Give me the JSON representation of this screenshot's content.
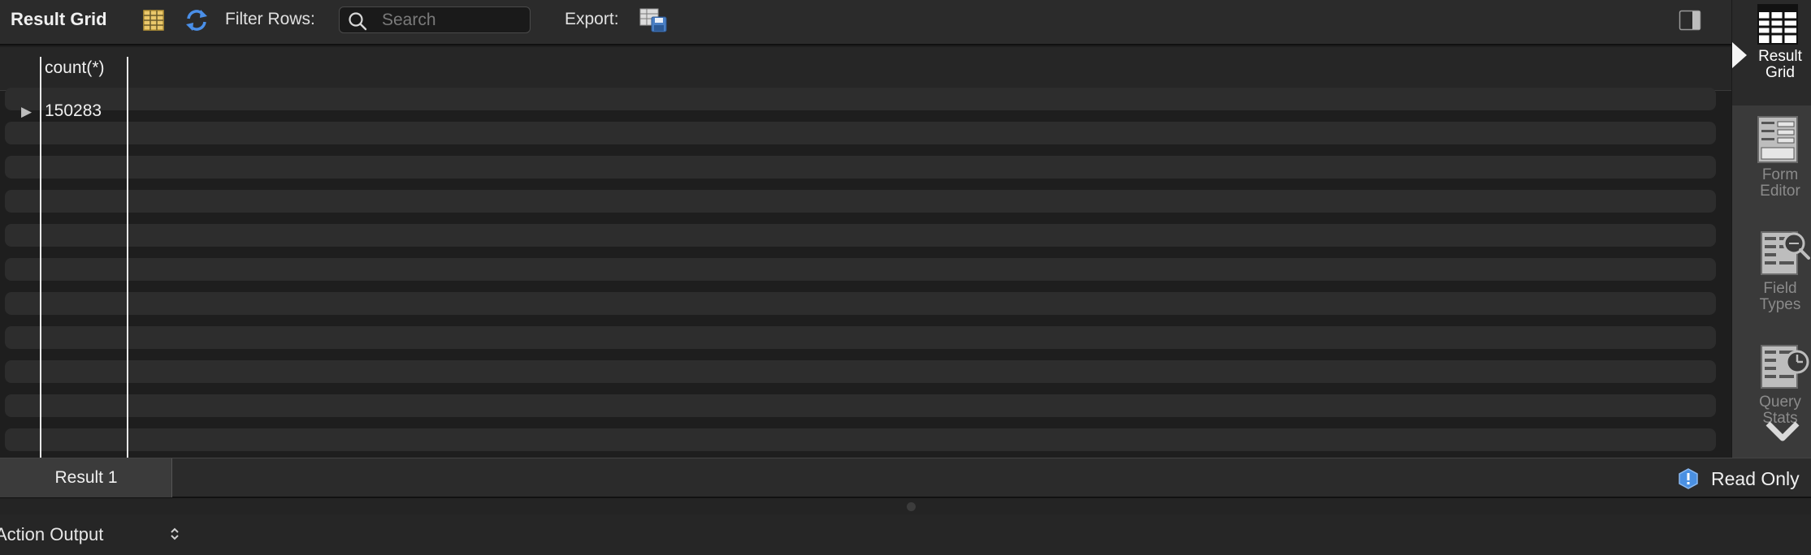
{
  "toolbar": {
    "title": "Result Grid",
    "grid_icon": "result-grid-icon",
    "refresh_icon": "refresh-icon",
    "filter_label": "Filter Rows:",
    "search_placeholder": "Search",
    "search_value": "",
    "export_label": "Export:",
    "export_icon": "export-icon",
    "panel_toggle_icon": "panel-toggle-icon"
  },
  "grid": {
    "columns": [
      "count(*)"
    ],
    "rows": [
      [
        "150283"
      ]
    ],
    "row_indicator": "▶"
  },
  "side_panel": {
    "items": [
      {
        "label_line1": "Result",
        "label_line2": "Grid",
        "icon": "result-grid-icon",
        "active": true
      },
      {
        "label_line1": "Form",
        "label_line2": "Editor",
        "icon": "form-editor-icon",
        "active": false
      },
      {
        "label_line1": "Field",
        "label_line2": "Types",
        "icon": "field-types-icon",
        "active": false
      },
      {
        "label_line1": "Query",
        "label_line2": "Stats",
        "icon": "query-stats-icon",
        "active": false
      }
    ],
    "more_icon": "chevron-down-icon"
  },
  "result_bar": {
    "tab_label": "Result 1",
    "status_label": "Read Only",
    "status_icon": "info-badge-icon"
  },
  "output": {
    "label": "Action Output",
    "selector_icon": "up-down-stepper-icon"
  },
  "colors": {
    "accent": "#4a90e2",
    "background": "#1e1e1e",
    "toolbar": "#2b2b2b",
    "side_panel": "#3a3a3a"
  }
}
